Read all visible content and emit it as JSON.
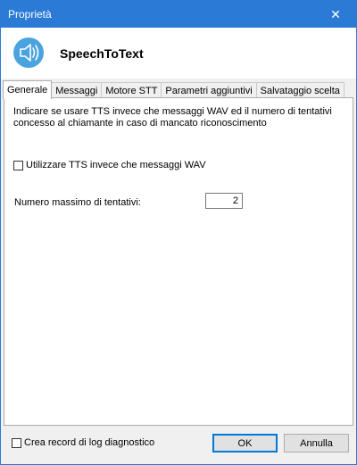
{
  "window": {
    "title": "Proprietà",
    "close_icon": "close-icon",
    "accent": "#2b7bd6"
  },
  "header": {
    "icon": "speaker-icon",
    "app_name": "SpeechToText"
  },
  "tabs": [
    {
      "label": "Generale",
      "active": true
    },
    {
      "label": "Messaggi",
      "active": false
    },
    {
      "label": "Motore STT",
      "active": false
    },
    {
      "label": "Parametri aggiuntivi",
      "active": false
    },
    {
      "label": "Salvataggio scelta",
      "active": false
    }
  ],
  "general": {
    "description": "Indicare se usare TTS invece che messaggi WAV ed il numero di tentativi concesso al chiamante in caso di mancato riconoscimento",
    "use_tts_label": "Utilizzare TTS invece che messaggi WAV",
    "use_tts_checked": false,
    "max_attempts_label": "Numero massimo di tentativi:",
    "max_attempts_value": "2"
  },
  "footer": {
    "log_label": "Crea record di log diagnostico",
    "log_checked": false,
    "ok_label": "OK",
    "cancel_label": "Annulla"
  }
}
